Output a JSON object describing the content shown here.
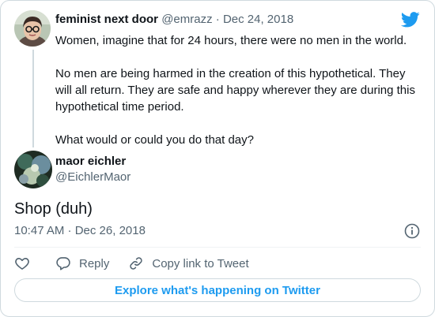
{
  "quoted": {
    "name": "feminist next door",
    "handle": "@emrazz",
    "dot": "·",
    "date": "Dec 24, 2018",
    "paragraphs": [
      "Women, imagine that for 24 hours, there were no men in the world.",
      "No men are being harmed in the creation of this hypothetical. They will all return. They are safe and happy wherever they are during this hypothetical time period.",
      "What would or could you do that day?"
    ]
  },
  "reply": {
    "name": "maor eichler",
    "handle": "@EichlerMaor",
    "text": "Shop (duh)",
    "timestamp": "10:47 AM · Dec 26, 2018"
  },
  "actions": {
    "reply_label": "Reply",
    "copy_label": "Copy link to Tweet"
  },
  "explore_label": "Explore what's happening on Twitter",
  "colors": {
    "accent": "#1d9bf0",
    "muted_text": "#536471",
    "border": "#cfd9de"
  },
  "icons": {
    "brand": "twitter-bird-icon",
    "info": "info-icon",
    "like": "heart-icon",
    "reply": "reply-bubble-icon",
    "copy": "link-icon"
  }
}
